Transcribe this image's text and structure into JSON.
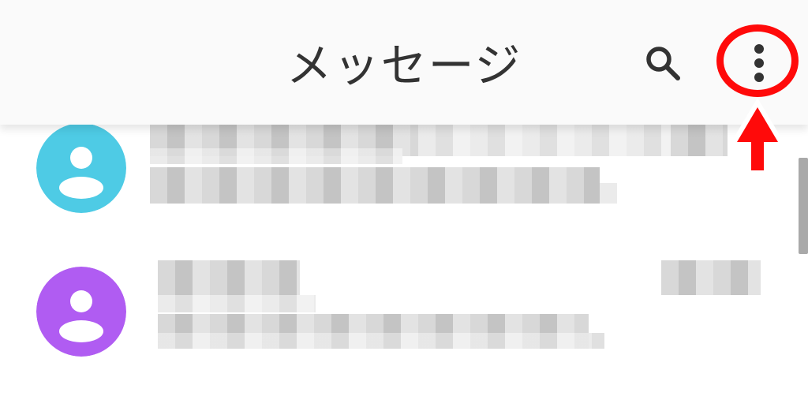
{
  "app_bar": {
    "title": "メッセージ",
    "search_icon": "search-icon",
    "more_icon": "more-vert-icon"
  },
  "conversations": [
    {
      "avatar_color": "#4ecbe5",
      "avatar_icon": "person-icon"
    },
    {
      "avatar_color": "#b05cf2",
      "avatar_icon": "person-icon"
    }
  ],
  "annotation": {
    "color": "#ff0a0a",
    "shapes": [
      "circle",
      "arrow"
    ]
  }
}
